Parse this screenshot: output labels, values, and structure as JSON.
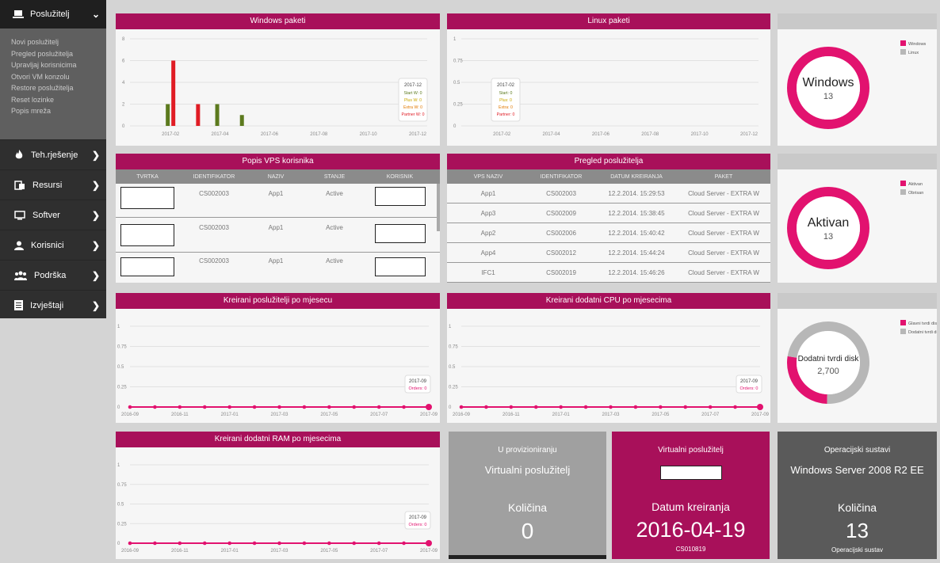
{
  "sidebar": {
    "top_label": "Poslužitelj",
    "submenu": [
      "Novi poslužitelj",
      "Pregled poslužitelja",
      "Upravljaj korisnicima",
      "Otvori VM konzolu",
      "Restore poslužitelja",
      "Reset lozinke",
      "Popis mreža"
    ],
    "items": [
      {
        "label": "Teh.rješenje",
        "icon": "fire-icon"
      },
      {
        "label": "Resursi",
        "icon": "resources-icon"
      },
      {
        "label": "Softver",
        "icon": "monitor-icon"
      },
      {
        "label": "Korisnici",
        "icon": "user-icon"
      },
      {
        "label": "Podrška",
        "icon": "users-icon"
      },
      {
        "label": "Izvještaji",
        "icon": "report-icon"
      }
    ]
  },
  "colors": {
    "magenta": "#a8105a",
    "pink": "#e2126f",
    "olive": "#5c7a1e",
    "red": "#e01c24",
    "gray": "#b7b7b7"
  },
  "windows_chart": {
    "title": "Windows paketi",
    "chart_data": {
      "type": "bar",
      "x": [
        "2017-02",
        "2017-04",
        "2017-06",
        "2017-08",
        "2017-10",
        "2017-12"
      ],
      "ylim": [
        0,
        8
      ],
      "yticks": [
        "0",
        "2",
        "4",
        "6",
        "8"
      ],
      "bars": [
        {
          "date": "2017-02",
          "series": "Start W",
          "value": 2
        },
        {
          "date": "2017-02",
          "series": "Partner W",
          "value": 6
        },
        {
          "date": "2017-03",
          "series": "Partner W",
          "value": 2
        },
        {
          "date": "2017-04",
          "series": "Start W",
          "value": 2
        },
        {
          "date": "2017-05",
          "series": "Start W",
          "value": 1
        }
      ],
      "tooltip": {
        "title": "2017-12",
        "lines": [
          {
            "text": "Start W: 0",
            "color": "#5c7a1e"
          },
          {
            "text": "Plus W: 0",
            "color": "#c8a600"
          },
          {
            "text": "Extra W: 0",
            "color": "#e27a00"
          },
          {
            "text": "Partner W: 0",
            "color": "#e01c24"
          }
        ]
      }
    }
  },
  "linux_chart": {
    "title": "Linux paketi",
    "chart_data": {
      "type": "bar",
      "x": [
        "2017-02",
        "2017-04",
        "2017-06",
        "2017-08",
        "2017-10",
        "2017-12"
      ],
      "ylim": [
        0,
        1
      ],
      "yticks": [
        "0",
        "0.25",
        "0.5",
        "0.75",
        "1"
      ],
      "bars": [],
      "tooltip": {
        "title": "2017-02",
        "lines": [
          {
            "text": "Start: 0",
            "color": "#5c7a1e"
          },
          {
            "text": "Plus: 0",
            "color": "#c8a600"
          },
          {
            "text": "Extra: 0",
            "color": "#e27a00"
          },
          {
            "text": "Partner: 0",
            "color": "#e01c24"
          }
        ]
      }
    }
  },
  "donut_os": {
    "center_title": "Windows",
    "center_value": "13",
    "chart_data": {
      "type": "pie",
      "slices": [
        {
          "name": "Windows",
          "value": 13,
          "color": "#e2126f"
        },
        {
          "name": "Linux",
          "value": 0,
          "color": "#b7b7b7"
        }
      ]
    }
  },
  "donut_status": {
    "center_title": "Aktivan",
    "center_value": "13",
    "chart_data": {
      "type": "pie",
      "slices": [
        {
          "name": "Aktivan",
          "value": 13,
          "color": "#e2126f"
        },
        {
          "name": "Obrisan",
          "value": 0,
          "color": "#b7b7b7"
        }
      ]
    }
  },
  "donut_disk": {
    "center_title": "Dodatni tvrdi disk",
    "center_value": "2,700",
    "chart_data": {
      "type": "pie",
      "slices": [
        {
          "name": "Glavni tvrdi disk",
          "value": 1000,
          "color": "#e2126f"
        },
        {
          "name": "Dodatni tvrdi disk",
          "value": 2700,
          "color": "#b7b7b7"
        }
      ]
    }
  },
  "vps_users": {
    "title": "Popis VPS korisnika",
    "columns": [
      "TVRTKA",
      "IDENTIFIKATOR",
      "NAZIV",
      "STANJE",
      "KORISNIK"
    ],
    "rows": [
      {
        "id": "CS002003",
        "name": "App1",
        "state": "Active"
      },
      {
        "id": "CS002003",
        "name": "App1",
        "state": "Active"
      },
      {
        "id": "CS002003",
        "name": "App1",
        "state": "Active"
      }
    ]
  },
  "server_list": {
    "title": "Pregled poslužitelja",
    "columns": [
      "VPS NAZIV",
      "IDENTIFIKATOR",
      "DATUM KREIRANJA",
      "PAKET"
    ],
    "rows": [
      [
        "App1",
        "CS002003",
        "12.2.2014. 15:29:53",
        "Cloud Server - EXTRA W"
      ],
      [
        "App3",
        "CS002009",
        "12.2.2014. 15:38:45",
        "Cloud Server - EXTRA W"
      ],
      [
        "App2",
        "CS002006",
        "12.2.2014. 15:40:42",
        "Cloud Server - EXTRA W"
      ],
      [
        "App4",
        "CS002012",
        "12.2.2014. 15:44:24",
        "Cloud Server - EXTRA W"
      ],
      [
        "IFC1",
        "CS002019",
        "12.2.2014. 15:46:26",
        "Cloud Server - EXTRA W"
      ]
    ]
  },
  "line_server": {
    "title": "Kreirani poslužitelji po mjesecu",
    "chart_data": {
      "type": "line",
      "x": [
        "2016-09",
        "2016-10",
        "2016-11",
        "2016-12",
        "2017-01",
        "2017-02",
        "2017-03",
        "2017-04",
        "2017-05",
        "2017-06",
        "2017-07",
        "2017-08",
        "2017-09"
      ],
      "xticks": [
        "2016-09",
        "2016-11",
        "2017-01",
        "2017-03",
        "2017-05",
        "2017-07",
        "2017-09"
      ],
      "yticks": [
        "0",
        "0.25",
        "0.5",
        "0.75",
        "1"
      ],
      "ylim": [
        0,
        1
      ],
      "series": [
        {
          "name": "Orders",
          "values": [
            0,
            0,
            0,
            0,
            0,
            0,
            0,
            0,
            0,
            0,
            0,
            0,
            0
          ]
        }
      ],
      "tooltip": {
        "title": "2017-09",
        "line": "Orders: 0"
      }
    }
  },
  "line_cpu": {
    "title": "Kreirani dodatni CPU po mjesecima",
    "chart_data": {
      "type": "line",
      "x": [
        "2016-09",
        "2016-10",
        "2016-11",
        "2016-12",
        "2017-01",
        "2017-02",
        "2017-03",
        "2017-04",
        "2017-05",
        "2017-06",
        "2017-07",
        "2017-08",
        "2017-09"
      ],
      "xticks": [
        "2016-09",
        "2016-11",
        "2017-01",
        "2017-03",
        "2017-05",
        "2017-07",
        "2017-09"
      ],
      "yticks": [
        "0",
        "0.25",
        "0.5",
        "0.75",
        "1"
      ],
      "ylim": [
        0,
        1
      ],
      "series": [
        {
          "name": "Orders",
          "values": [
            0,
            0,
            0,
            0,
            0,
            0,
            0,
            0,
            0,
            0,
            0,
            0,
            0
          ]
        }
      ],
      "tooltip": {
        "title": "2017-09",
        "line": "Orders: 0"
      }
    }
  },
  "line_ram": {
    "title": "Kreirani dodatni RAM po mjesecima",
    "chart_data": {
      "type": "line",
      "x": [
        "2016-09",
        "2016-10",
        "2016-11",
        "2016-12",
        "2017-01",
        "2017-02",
        "2017-03",
        "2017-04",
        "2017-05",
        "2017-06",
        "2017-07",
        "2017-08",
        "2017-09"
      ],
      "xticks": [
        "2016-09",
        "2016-11",
        "2017-01",
        "2017-03",
        "2017-05",
        "2017-07",
        "2017-09"
      ],
      "yticks": [
        "0",
        "0.25",
        "0.5",
        "0.75",
        "1"
      ],
      "ylim": [
        0,
        1
      ],
      "series": [
        {
          "name": "Orders",
          "values": [
            0,
            0,
            0,
            0,
            0,
            0,
            0,
            0,
            0,
            0,
            0,
            0,
            0
          ]
        }
      ],
      "tooltip": {
        "title": "2017-09",
        "line": "Orders: 0"
      }
    }
  },
  "tile_prov": {
    "header": "U provizioniranju",
    "sub": "Virtualni poslužitelj",
    "label": "Količina",
    "value": "0"
  },
  "tile_vs": {
    "header": "Virtualni poslužitelj",
    "label": "Datum kreiranja",
    "value": "2016-04-19",
    "code": "CS010819"
  },
  "tile_os": {
    "header": "Operacijski sustavi",
    "sub": "Windows Server 2008 R2 EE",
    "label": "Količina",
    "value": "13",
    "footer": "Operacijski sustav"
  }
}
